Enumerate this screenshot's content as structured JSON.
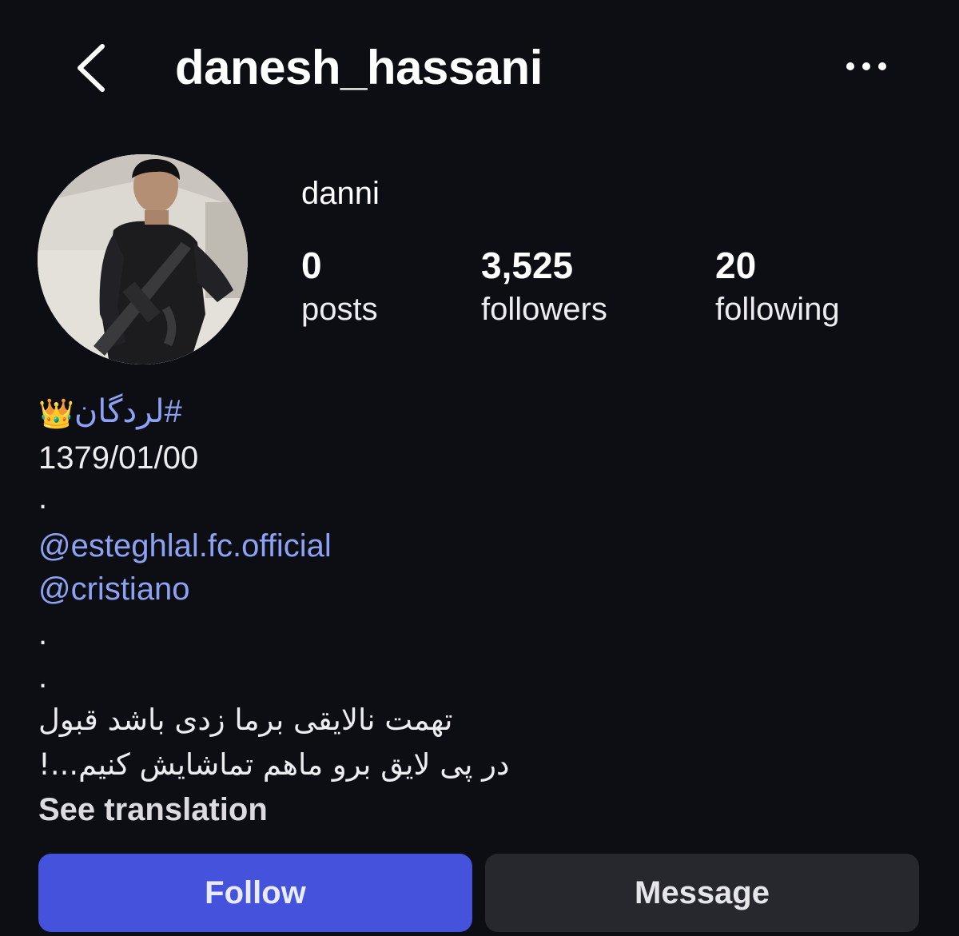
{
  "header": {
    "username": "danesh_hassani",
    "back_icon": "chevron-left-icon",
    "more_icon": "more-horizontal-icon"
  },
  "profile": {
    "display_name": "danni",
    "stats": {
      "posts_count": "0",
      "posts_label": "posts",
      "followers_count": "3,525",
      "followers_label": "followers",
      "following_count": "20",
      "following_label": "following"
    }
  },
  "bio": {
    "hashtag": "#لردگان",
    "crown_emoji": "👑",
    "date": "1379/01/00",
    "dot": ".",
    "mentions": [
      "@esteghlal.fc.official",
      "@cristiano"
    ],
    "persian_line_1": "تهمت نالایقی برما زدی باشد قبول",
    "persian_line_2": "در پی لایق برو ماهم تماشایش کنیم...!",
    "see_translation": "See translation"
  },
  "actions": {
    "follow_label": "Follow",
    "message_label": "Message"
  },
  "colors": {
    "background": "#0c0e14",
    "link": "#8da2f2",
    "follow_button": "#4452dc",
    "message_button": "#26282e"
  }
}
